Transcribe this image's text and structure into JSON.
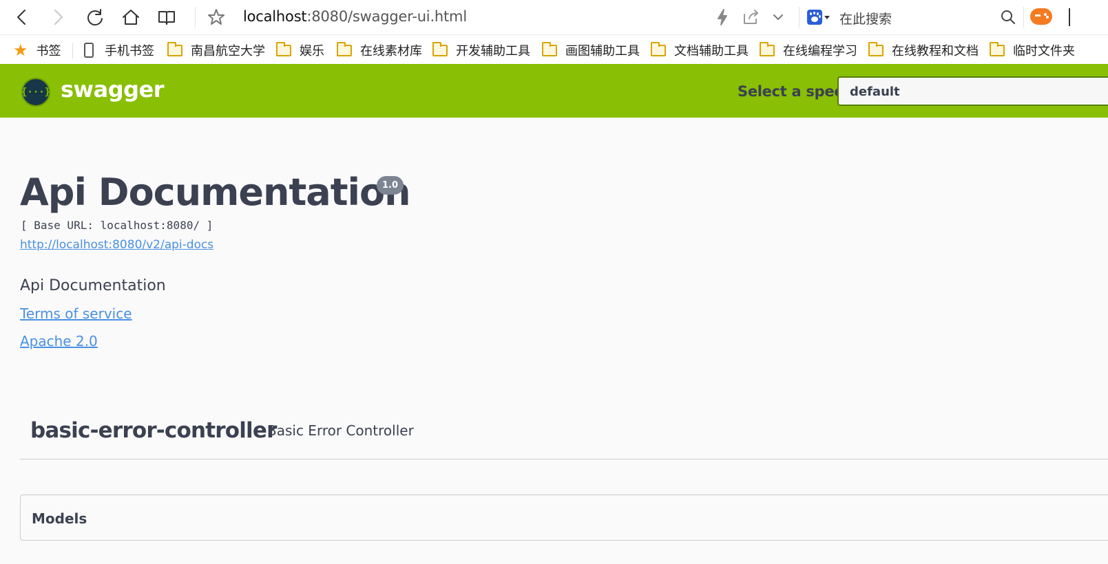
{
  "browser": {
    "url_host": "localhost",
    "url_rest": ":8080/swagger-ui.html",
    "search_placeholder": "在此搜索",
    "bookmarks": [
      "书签",
      "手机书签",
      "南昌航空大学",
      "娱乐",
      "在线素材库",
      "开发辅助工具",
      "画图辅助工具",
      "文档辅助工具",
      "在线编程学习",
      "在线教程和文档",
      "临时文件夹"
    ]
  },
  "topbar": {
    "logo_glyph": "{···}",
    "logo_text": "swagger",
    "spec_label": "Select a spec",
    "spec_value": "default",
    "accent_color": "#89bf04"
  },
  "info": {
    "title": "Api Documentation",
    "version": "1.0",
    "base_url": "[ Base URL: localhost:8080/ ]",
    "api_docs_link": "http://localhost:8080/v2/api-docs",
    "description": "Api Documentation",
    "terms_link": "Terms of service",
    "license_link": "Apache 2.0"
  },
  "tags": [
    {
      "name": "basic-error-controller",
      "description": "Basic Error Controller"
    }
  ],
  "models": {
    "title": "Models"
  },
  "icons": [
    "back-icon",
    "forward-icon",
    "reload-icon",
    "home-icon",
    "reader-icon",
    "star-icon",
    "lightning-icon",
    "share-icon",
    "chevron-down-icon",
    "baidu-paw-icon",
    "search-icon",
    "game-icon"
  ]
}
